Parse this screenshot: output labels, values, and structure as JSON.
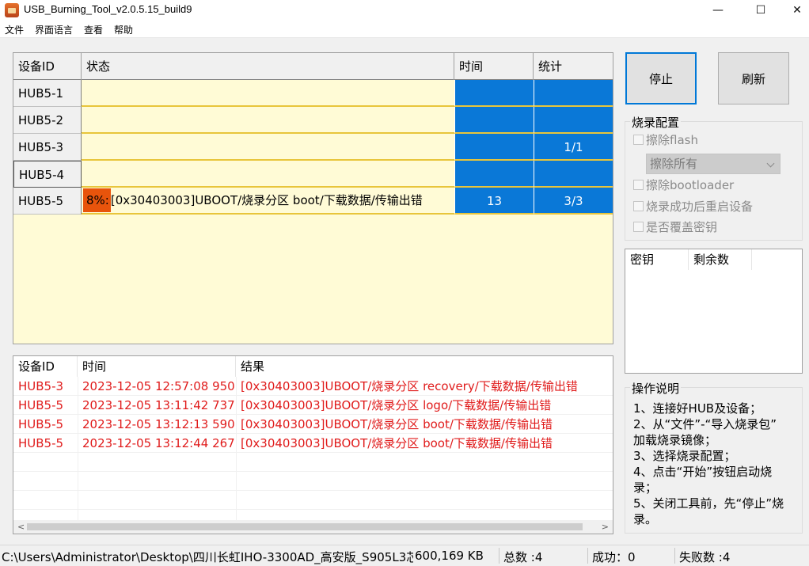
{
  "window": {
    "title": "USB_Burning_Tool_v2.0.5.15_build9",
    "minimize": "—",
    "maximize": "☐",
    "close": "✕"
  },
  "menu": [
    "文件",
    "界面语言",
    "查看",
    "帮助"
  ],
  "device_table": {
    "headers": [
      "设备ID",
      "状态",
      "时间",
      "统计"
    ],
    "rows": [
      {
        "id": "HUB5-1",
        "progress": "",
        "status": "",
        "time": "",
        "stat": ""
      },
      {
        "id": "HUB5-2",
        "progress": "",
        "status": "",
        "time": "",
        "stat": ""
      },
      {
        "id": "HUB5-3",
        "progress": "",
        "status": "",
        "time": "",
        "stat": "1/1"
      },
      {
        "id": "HUB5-4",
        "progress": "",
        "status": "",
        "time": "",
        "stat": ""
      },
      {
        "id": "HUB5-5",
        "progress": "8%:",
        "status": "[0x30403003]UBOOT/烧录分区 boot/下载数据/传输出错",
        "time": "13",
        "stat": "3/3"
      }
    ]
  },
  "buttons": {
    "stop": "停止",
    "refresh": "刷新"
  },
  "burn_config": {
    "title": "烧录配置",
    "erase_flash": "擦除flash",
    "erase_mode": "擦除所有",
    "erase_bootloader": "擦除bootloader",
    "reboot_after": "烧录成功后重启设备",
    "overwrite_key": "是否覆盖密钥"
  },
  "key_table": {
    "headers": [
      "密钥",
      "剩余数"
    ]
  },
  "log_table": {
    "headers": [
      "设备ID",
      "时间",
      "结果"
    ],
    "rows": [
      {
        "id": "HUB5-3",
        "time": "2023-12-05 12:57:08 950",
        "result": "[0x30403003]UBOOT/烧录分区 recovery/下载数据/传输出错"
      },
      {
        "id": "HUB5-5",
        "time": "2023-12-05 13:11:42 737",
        "result": "[0x30403003]UBOOT/烧录分区 logo/下载数据/传输出错"
      },
      {
        "id": "HUB5-5",
        "time": "2023-12-05 13:12:13 590",
        "result": "[0x30403003]UBOOT/烧录分区 boot/下载数据/传输出错"
      },
      {
        "id": "HUB5-5",
        "time": "2023-12-05 13:12:44 267",
        "result": "[0x30403003]UBOOT/烧录分区 boot/下载数据/传输出错"
      }
    ]
  },
  "instructions": {
    "title": "操作说明",
    "lines": [
      "1、连接好HUB及设备；",
      "2、从“文件”-“导入烧录包”",
      "加载烧录镜像；",
      "3、选择烧录配置；",
      "4、点击“开始”按钮启动烧",
      "录；",
      "5、关闭工具前，先“停止”烧",
      "录。"
    ]
  },
  "status_bar": {
    "path": "C:\\Users\\Administrator\\Desktop\\四川长虹IHO-3300AD_高安版_S905L3芯",
    "size": "600,169 KB",
    "total": "总数 :4",
    "success": "成功：0",
    "fail": "失败数 :4"
  },
  "colors": {
    "grid_bg": "#fffbd6",
    "cell_blue": "#0a78d7",
    "progress_orange": "#e8540c",
    "error_red": "#e01b1b"
  }
}
